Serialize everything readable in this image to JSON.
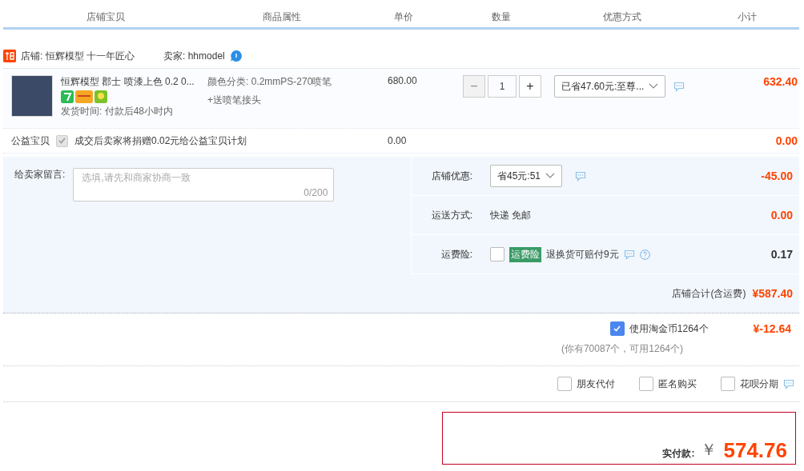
{
  "columns": [
    "店铺宝贝",
    "商品属性",
    "单价",
    "数量",
    "优惠方式",
    "小计"
  ],
  "shop": {
    "label": "店铺: 恒辉模型 十一年匠心",
    "seller": "卖家: hhmodel"
  },
  "item": {
    "title": "恒辉模型 郡士 喷漆上色 0.2 0...",
    "shipping_time": "发货时间: 付款后48小时内",
    "attributes": [
      "颜色分类: 0.2mmPS-270喷笔",
      "+送喷笔接头"
    ],
    "price": "680.00",
    "decrease_label": "−",
    "quantity": "1",
    "increase_label": "+",
    "decrease_disabled": true,
    "discount": "已省47.60元:至尊...",
    "subtotal": "632.40"
  },
  "charity": {
    "label": "公益宝贝",
    "checked": true,
    "disabled": true,
    "text": "成交后卖家将捐赠0.02元给公益宝贝计划",
    "price": "0.00",
    "subtotal": "0.00"
  },
  "message": {
    "label": "给卖家留言:",
    "placeholder": "选填,请先和商家协商一致",
    "counter": "0/200"
  },
  "shop_options": [
    {
      "kind": "select",
      "label": "店铺优惠:",
      "value": "省45元:51",
      "amount": "-45.00",
      "highlighted": true
    },
    {
      "kind": "text",
      "label": "运送方式:",
      "value": "快递 免邮",
      "amount": "0.00",
      "highlighted": true
    },
    {
      "kind": "insurance",
      "label": "运费险:",
      "checked": false,
      "tag": "运费险",
      "value": "退换货可赔付9元",
      "amount": "0.17",
      "highlighted": false
    }
  ],
  "shop_total": {
    "label": "店铺合计(含运费)",
    "amount": "¥587.40"
  },
  "coins": {
    "checked": true,
    "label": "使用淘金币1264个",
    "amount": "¥-12.64",
    "note": "(你有70087个，可用1264个)"
  },
  "pay_options": [
    {
      "label": "朋友代付",
      "checked": false
    },
    {
      "label": "匿名购买",
      "checked": false
    },
    {
      "label": "花呗分期",
      "checked": false
    }
  ],
  "payment": {
    "label": "实付款:",
    "currency": "￥",
    "amount": "574.76"
  }
}
